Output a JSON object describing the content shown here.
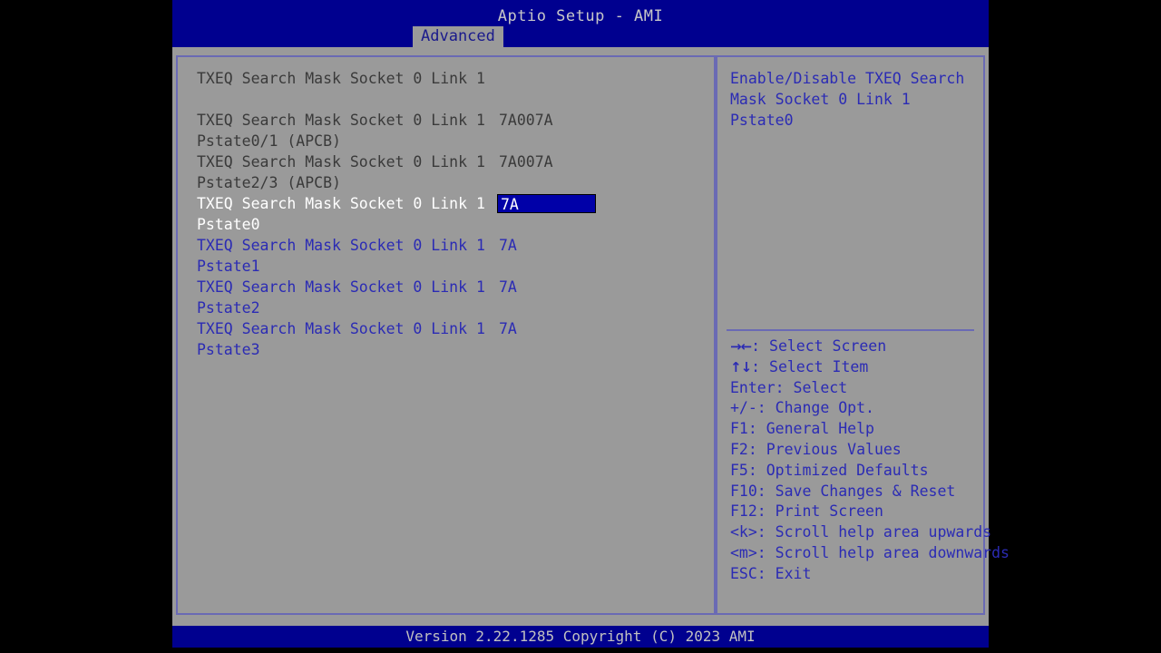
{
  "window": {
    "title": "Aptio Setup - AMI",
    "version_bar": "Version 2.22.1285 Copyright (C) 2023 AMI"
  },
  "tabs": {
    "active": "Advanced"
  },
  "main": {
    "section_heading": "TXEQ Search Mask Socket 0 Link 1",
    "rows": [
      {
        "label": "TXEQ Search Mask Socket 0 Link 1 Pstate0/1 (APCB)",
        "value": "7A007A",
        "state": "disabled"
      },
      {
        "label": "TXEQ Search Mask Socket 0 Link 1 Pstate2/3 (APCB)",
        "value": "7A007A",
        "state": "disabled"
      },
      {
        "label": "TXEQ Search Mask Socket 0 Link 1 Pstate0",
        "value": "7A",
        "state": "selected"
      },
      {
        "label": "TXEQ Search Mask Socket 0 Link 1 Pstate1",
        "value": "7A",
        "state": "normal"
      },
      {
        "label": "TXEQ Search Mask Socket 0 Link 1 Pstate2",
        "value": "7A",
        "state": "normal"
      },
      {
        "label": "TXEQ Search Mask Socket 0 Link 1 Pstate3",
        "value": "7A",
        "state": "normal"
      }
    ]
  },
  "help": {
    "description": "Enable/Disable TXEQ Search Mask Socket 0 Link 1 Pstate0",
    "keys": [
      {
        "glyph": "→←",
        "text": ": Select Screen"
      },
      {
        "glyph": "↑↓",
        "text": ": Select Item"
      },
      {
        "glyph": "",
        "text": "Enter: Select"
      },
      {
        "glyph": "",
        "text": "+/-: Change Opt."
      },
      {
        "glyph": "",
        "text": "F1: General Help"
      },
      {
        "glyph": "",
        "text": "F2: Previous Values"
      },
      {
        "glyph": "",
        "text": "F5: Optimized Defaults"
      },
      {
        "glyph": "",
        "text": "F10: Save Changes & Reset"
      },
      {
        "glyph": "",
        "text": "F12: Print Screen"
      },
      {
        "glyph": "",
        "text": "<k>: Scroll help area upwards"
      },
      {
        "glyph": "",
        "text": "<m>: Scroll help area downwards"
      },
      {
        "glyph": "",
        "text": "ESC: Exit"
      }
    ]
  },
  "colors": {
    "header_blue": "#00008F",
    "panel_gray": "#9A9A9A",
    "border_violet": "#6A6AB4",
    "text_blue": "#2B2BB4",
    "text_dim": "#3A3A3A",
    "highlight_bg": "#0000A8",
    "highlight_fg": "#FFFFFF"
  }
}
